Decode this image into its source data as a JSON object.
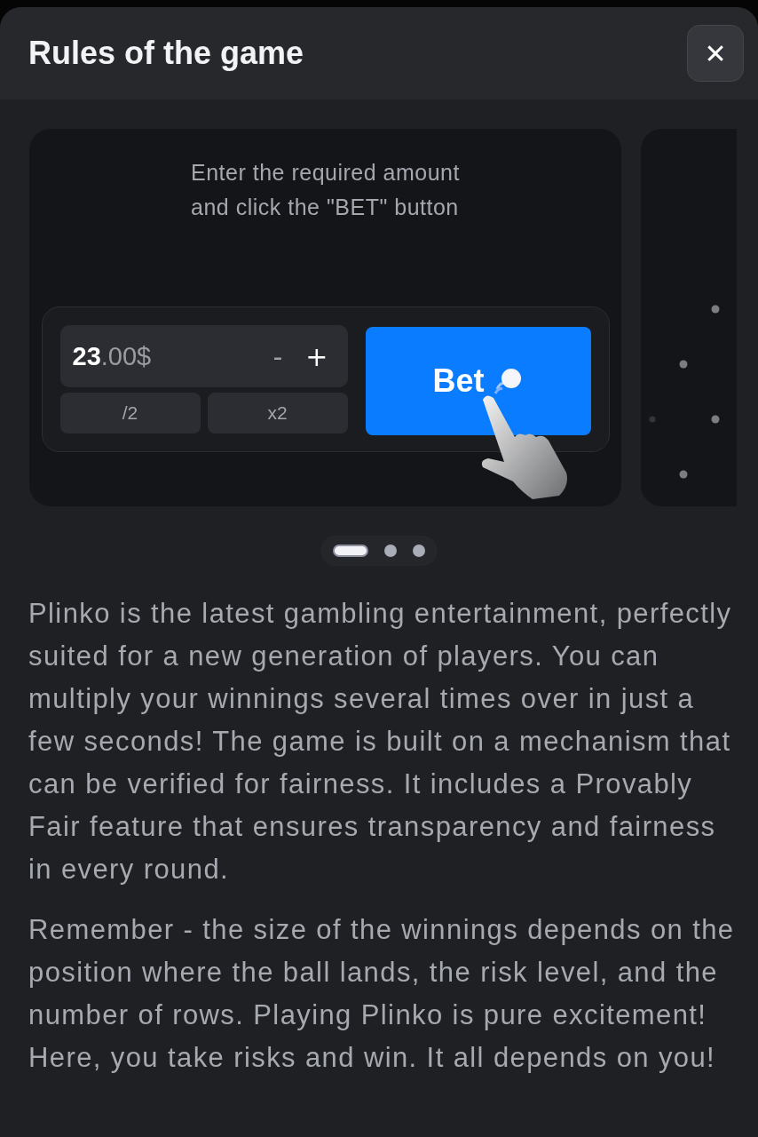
{
  "header": {
    "title": "Rules of the game",
    "close_icon": "✕"
  },
  "slides": [
    {
      "kind": "bet",
      "selected": true,
      "caption": "Enter the required amount\nand click the \"BET\" button",
      "amount_whole": "23",
      "amount_rest": ".00$",
      "minus": "-",
      "plus": "+",
      "half": "/2",
      "double": "x2",
      "bet_label": "Bet"
    },
    {
      "kind": "board",
      "selected": false
    }
  ],
  "pager": [
    {
      "selected": true
    },
    {
      "selected": false
    },
    {
      "selected": false
    }
  ],
  "paragraphs": [
    "Plinko is the latest gambling entertainment, perfectly suited for a new generation of players. You can multiply your winnings several times over in just a few seconds! The game is built on a mechanism that can be verified for fairness. It includes a Provably Fair feature that ensures transparency and fairness in every round.",
    "Remember - the size of the winnings depends on the position where the ball lands, the risk level, and the number of rows. Playing Plinko is pure excitement! Here, you take risks and win. It all depends on you!"
  ]
}
